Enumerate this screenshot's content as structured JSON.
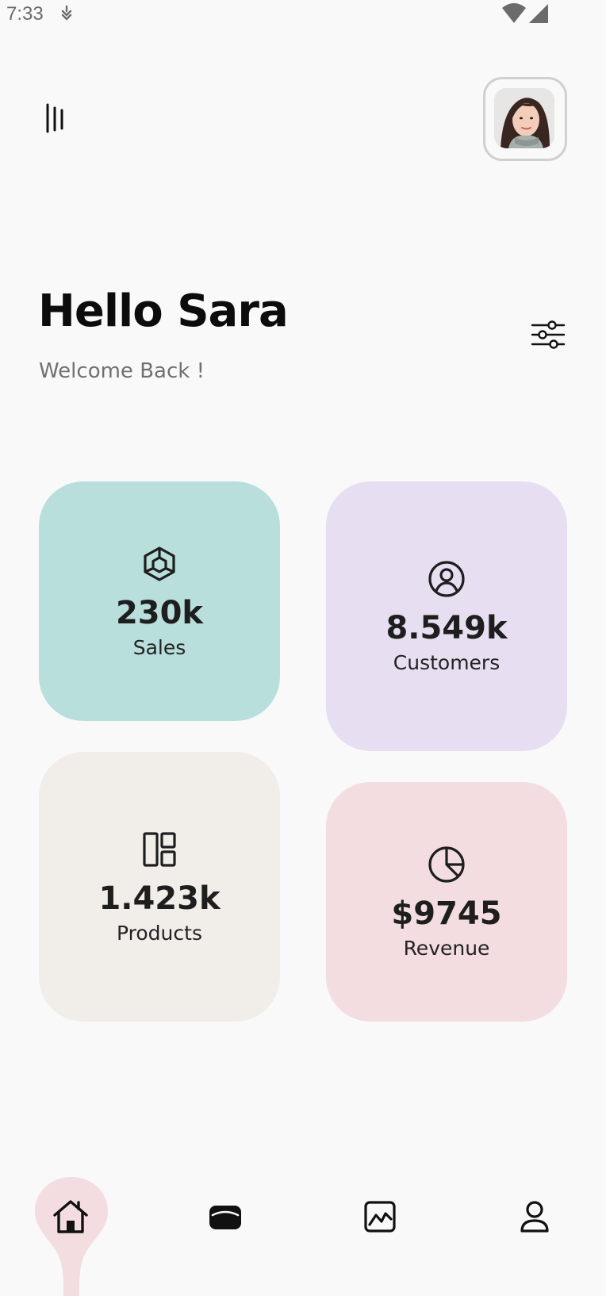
{
  "status_bar": {
    "time": "7:33",
    "icons": [
      "dnd-icon",
      "wifi-icon",
      "cellular-icon"
    ]
  },
  "header": {
    "menu_icon": "menu-bars-icon",
    "avatar": "user-avatar-photo"
  },
  "greeting": {
    "title": "Hello Sara",
    "subtitle": "Welcome Back !",
    "filter_icon": "sliders-icon"
  },
  "stats": [
    {
      "icon": "cube-icon",
      "value": "230k",
      "label": "Sales",
      "color": "#b9dfdc"
    },
    {
      "icon": "user-circle-icon",
      "value": "8.549k",
      "label": "Customers",
      "color": "#e8def1"
    },
    {
      "icon": "layout-icon",
      "value": "1.423k",
      "label": "Products",
      "color": "#f1eeea"
    },
    {
      "icon": "pie-chart-icon",
      "value": "$9745",
      "label": "Revenue",
      "color": "#f4dde0"
    }
  ],
  "bottom_nav": {
    "items": [
      "home-icon",
      "wallet-icon",
      "chart-icon",
      "profile-icon"
    ],
    "active": "home",
    "accent": "#f4dde0"
  }
}
